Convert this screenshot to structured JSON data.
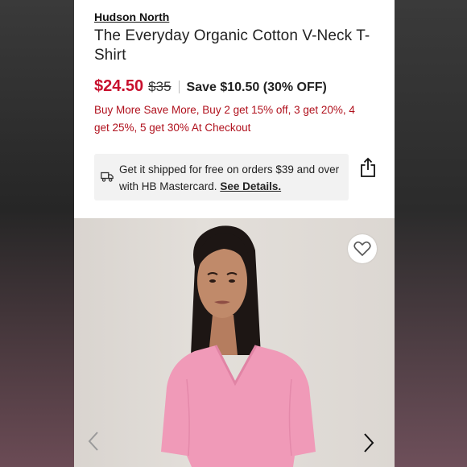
{
  "product": {
    "brand": "Hudson North",
    "title": "The Everyday Organic Cotton V-Neck T-Shirt",
    "price_now": "$24.50",
    "price_was": "$35",
    "save_text": "Save $10.50 (30% OFF)",
    "promo": "Buy More Save More, Buy 2 get 15% off, 3 get 20%, 4 get 25%, 5 get 30% At Checkout"
  },
  "shipping": {
    "text": "Get it shipped for free on orders $39 and over with HB Mastercard.",
    "link_label": "See Details."
  },
  "icons": {
    "truck": "truck-icon",
    "share": "share-icon",
    "favorite": "heart-icon",
    "prev": "chevron-left-icon",
    "next": "chevron-right-icon"
  },
  "colors": {
    "sale_price": "#c8102e",
    "promo_text": "#b0111d",
    "shirt": "#f09ab8"
  }
}
